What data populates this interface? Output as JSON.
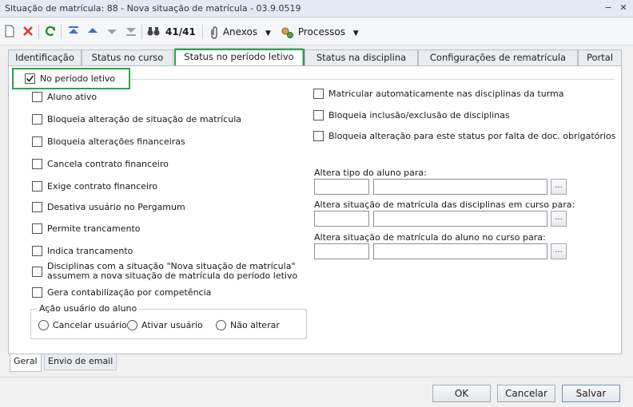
{
  "window": {
    "title": "Situação de matrícula: 88 - Nova situação de matrícula - 03.9.0519"
  },
  "toolbar": {
    "record_counter": "41/41",
    "attachments_label": "Anexos",
    "processes_label": "Processos"
  },
  "tabs": [
    {
      "label": "Identificação"
    },
    {
      "label": "Status no curso"
    },
    {
      "label": "Status no período letivo"
    },
    {
      "label": "Status na disciplina"
    },
    {
      "label": "Configurações de rematrícula"
    },
    {
      "label": "Portal"
    }
  ],
  "panel": {
    "header_checkbox": {
      "label": "No período letivo",
      "checked": true
    },
    "left_options": [
      {
        "label": "Aluno ativo",
        "checked": false
      },
      {
        "label": "Bloqueia alteração de situação de matrícula",
        "checked": false
      },
      {
        "label": "Bloqueia alterações financeiras",
        "checked": false
      },
      {
        "label": "Cancela contrato financeiro",
        "checked": false
      },
      {
        "label": "Exige contrato financeiro",
        "checked": false
      },
      {
        "label": "Desativa usuário no Pergamum",
        "checked": false
      },
      {
        "label": "Permite trancamento",
        "checked": false
      },
      {
        "label": "Indica trancamento",
        "checked": false
      },
      {
        "label": "Disciplinas com a situação \"Nova situação de matrícula\" assumem a nova situação de matrícula do período letivo",
        "checked": false
      },
      {
        "label": "Gera contabilização por competência",
        "checked": false
      }
    ],
    "right_options": [
      {
        "label": "Matricular automaticamente nas disciplinas da turma",
        "checked": false
      },
      {
        "label": "Bloqueia inclusão/exclusão de disciplinas",
        "checked": false
      },
      {
        "label": "Bloqueia alteração para este status por falta de doc. obrigatórios",
        "checked": false
      }
    ],
    "fields": [
      {
        "label": "Altera tipo do aluno para:",
        "code": "",
        "description": ""
      },
      {
        "label": "Altera situação de matrícula das disciplinas em curso para:",
        "code": "",
        "description": ""
      },
      {
        "label": "Altera situação de matrícula do aluno no curso para:",
        "code": "",
        "description": ""
      }
    ],
    "ellipsis_label": "...",
    "user_action": {
      "title": "Ação usuário do aluno",
      "options": [
        {
          "label": "Cancelar usuário",
          "selected": false
        },
        {
          "label": "Ativar usuário",
          "selected": false
        },
        {
          "label": "Não alterar",
          "selected": false
        }
      ]
    }
  },
  "bottom_tabs": [
    {
      "label": "Geral"
    },
    {
      "label": "Envio de email"
    }
  ],
  "buttons": {
    "ok": "OK",
    "cancel": "Cancelar",
    "save": "Salvar"
  },
  "colors": {
    "highlight": "#2aa44a",
    "delete_red": "#d93a2e",
    "refresh_green": "#2e8b2e",
    "nav_blue": "#3a6fc4"
  }
}
